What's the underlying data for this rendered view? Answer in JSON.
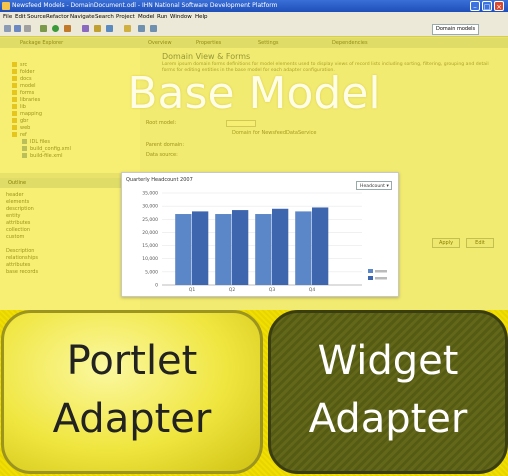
{
  "window": {
    "title": "Newsfeed Models - DomainDocument.odl - IHN National Software Development Platform",
    "menu": [
      "File",
      "Edit",
      "Source",
      "Refactor",
      "Navigate",
      "Search",
      "Project",
      "Model",
      "Run",
      "Window",
      "Help"
    ],
    "perspective": "Domain models"
  },
  "tabs": [
    "Package Explorer",
    "Overview",
    "Properties",
    "Settings",
    "Dependencies"
  ],
  "explorer": {
    "items": [
      "src",
      "folder",
      "docs",
      "model",
      "forms",
      "libraries",
      "lib",
      "mapping",
      "gbr",
      "web",
      "ref",
      "IDL files",
      "build_config.xml",
      "build-file.xml"
    ]
  },
  "outline": {
    "header": "Outline",
    "rows": [
      "header",
      "elements",
      "description",
      "entity",
      "attributes",
      "collection",
      "custom",
      "",
      "Description",
      "relationships",
      "attributes",
      "base records"
    ]
  },
  "editor": {
    "title": "Domain View & Forms",
    "description": "Lorem ipsum domain forms definitions for model elements used to display views of record lists including sorting, filtering, grouping and detail forms for editing entities in the base model for each adapter configuration.",
    "fields": [
      {
        "label": "Root model:",
        "value": ""
      },
      {
        "label": "Parent domain:",
        "value": "Domain for NewsfeedDataService"
      },
      {
        "label": "Data source:",
        "value": ""
      }
    ],
    "buttons": [
      "Apply",
      "Edit"
    ]
  },
  "chart_data": {
    "type": "bar",
    "title": "Quarterly Headcount 2007",
    "dropdown": "Headcount",
    "categories": [
      "Q1",
      "Q2",
      "Q3",
      "Q4"
    ],
    "series": [
      {
        "name": "",
        "values": [
          27000,
          27000,
          27000,
          28000
        ]
      },
      {
        "name": "",
        "values": [
          28000,
          28500,
          29000,
          29500
        ]
      }
    ],
    "y_ticks": [
      "35,000",
      "30,000",
      "25,000",
      "20,000",
      "15,000",
      "10,000",
      "5,000",
      "0"
    ],
    "ylim": [
      0,
      35000
    ],
    "colors": [
      "#5b86c7",
      "#3d66ae"
    ],
    "legend": "bottom-right"
  },
  "overlay": {
    "base_model": "Base Model",
    "portlet": [
      "Portlet",
      "Adapter"
    ],
    "widget": [
      "Widget",
      "Adapter"
    ]
  }
}
